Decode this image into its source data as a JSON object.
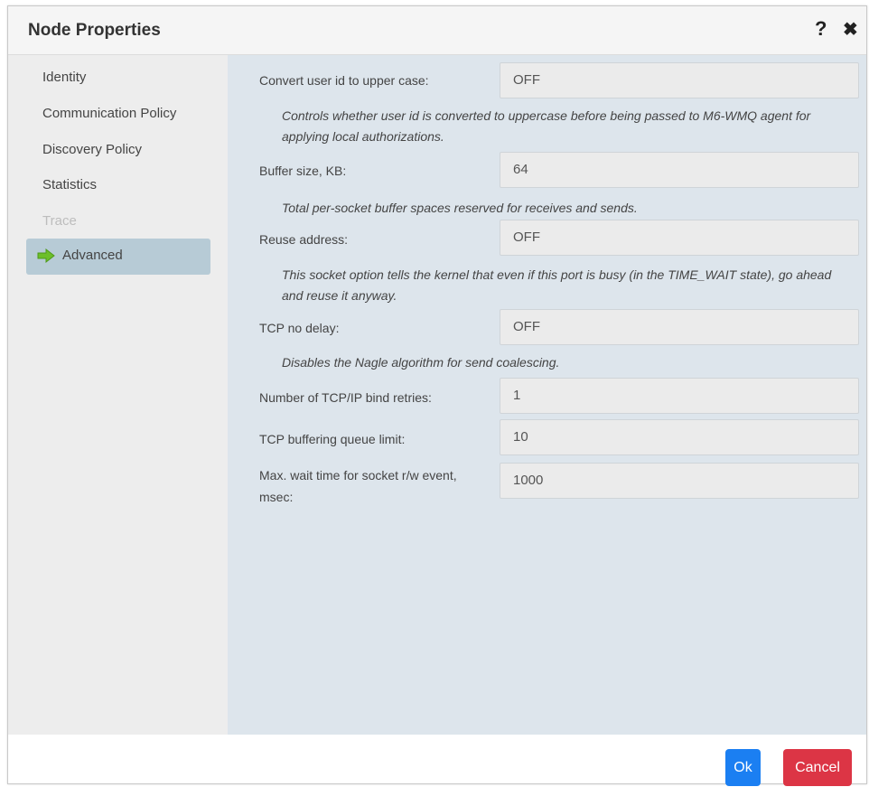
{
  "dialog": {
    "title": "Node Properties",
    "help_glyph": "?",
    "close_glyph": "✖"
  },
  "sidebar": {
    "items": [
      {
        "label": "Identity",
        "state": "normal"
      },
      {
        "label": "Communication Policy",
        "state": "normal"
      },
      {
        "label": "Discovery Policy",
        "state": "normal"
      },
      {
        "label": "Statistics",
        "state": "normal"
      },
      {
        "label": "Trace",
        "state": "disabled"
      },
      {
        "label": "Advanced",
        "state": "active",
        "icon": "arrow-right-icon"
      }
    ]
  },
  "form": {
    "convert_user_id": {
      "label": "Convert user id to upper case:",
      "value": "OFF",
      "description": "Controls whether user id is converted to uppercase before being passed to M6-WMQ agent for applying local authorizations."
    },
    "buffer_size": {
      "label": "Buffer size, KB:",
      "value": "64",
      "description": "Total per-socket buffer spaces reserved for receives and sends."
    },
    "reuse_address": {
      "label": "Reuse address:",
      "value": "OFF",
      "description": "This socket option tells the kernel that even if this port is busy (in the TIME_WAIT state), go ahead and reuse it anyway."
    },
    "tcp_no_delay": {
      "label": "TCP no delay:",
      "value": "OFF",
      "description": "Disables the Nagle algorithm for send coalescing."
    },
    "bind_retries": {
      "label": "Number of TCP/IP bind retries:",
      "value": "1"
    },
    "queue_limit": {
      "label": "TCP buffering queue limit:",
      "value": "10"
    },
    "max_wait": {
      "label": "Max. wait time for socket r/w event, msec:",
      "value": "1000"
    }
  },
  "footer": {
    "ok_label": "Ok",
    "cancel_label": "Cancel"
  },
  "colors": {
    "ok_button": "#1b7ff2",
    "cancel_button": "#dc3545",
    "active_nav": "#b7cbd6",
    "arrow_icon": "#6cbf2a"
  }
}
